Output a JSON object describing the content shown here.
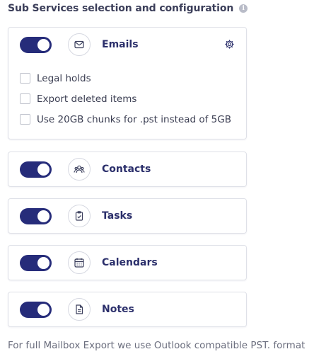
{
  "header": {
    "title": "Sub Services selection and configuration",
    "info_icon": "info-icon"
  },
  "services": [
    {
      "label": "Emails",
      "enabled": true,
      "icon": "envelope-icon",
      "settings_icon": "gear-icon",
      "options": [
        {
          "label": "Legal holds",
          "checked": false
        },
        {
          "label": "Export deleted items",
          "checked": false
        },
        {
          "label": "Use 20GB chunks for .pst instead of 5GB",
          "checked": false
        }
      ]
    },
    {
      "label": "Contacts",
      "enabled": true,
      "icon": "people-icon"
    },
    {
      "label": "Tasks",
      "enabled": true,
      "icon": "clipboard-check-icon"
    },
    {
      "label": "Calendars",
      "enabled": true,
      "icon": "calendar-icon"
    },
    {
      "label": "Notes",
      "enabled": true,
      "icon": "note-icon"
    }
  ],
  "footer": {
    "text": "For full Mailbox Export we use Outlook compatible PST. format"
  },
  "colors": {
    "toggle_on": "#262c7a",
    "label": "#2b2f6b",
    "border": "#dfe1e8"
  }
}
